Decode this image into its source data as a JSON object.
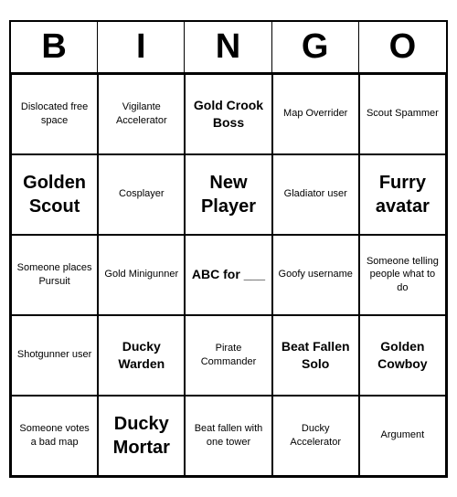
{
  "header": {
    "letters": [
      "B",
      "I",
      "N",
      "G",
      "O"
    ]
  },
  "cells": [
    {
      "text": "Dislocated free space",
      "size": "small"
    },
    {
      "text": "Vigilante Accelerator",
      "size": "small"
    },
    {
      "text": "Gold Crook Boss",
      "size": "medium"
    },
    {
      "text": "Map Overrider",
      "size": "small"
    },
    {
      "text": "Scout Spammer",
      "size": "small"
    },
    {
      "text": "Golden Scout",
      "size": "large"
    },
    {
      "text": "Cosplayer",
      "size": "small"
    },
    {
      "text": "New Player",
      "size": "large"
    },
    {
      "text": "Gladiator user",
      "size": "small"
    },
    {
      "text": "Furry avatar",
      "size": "large"
    },
    {
      "text": "Someone places Pursuit",
      "size": "small"
    },
    {
      "text": "Gold Minigunner",
      "size": "small"
    },
    {
      "text": "ABC for ___",
      "size": "medium"
    },
    {
      "text": "Goofy username",
      "size": "small"
    },
    {
      "text": "Someone telling people what to do",
      "size": "small"
    },
    {
      "text": "Shotgunner user",
      "size": "small"
    },
    {
      "text": "Ducky Warden",
      "size": "medium"
    },
    {
      "text": "Pirate Commander",
      "size": "small"
    },
    {
      "text": "Beat Fallen Solo",
      "size": "medium"
    },
    {
      "text": "Golden Cowboy",
      "size": "medium"
    },
    {
      "text": "Someone votes a bad map",
      "size": "small"
    },
    {
      "text": "Ducky Mortar",
      "size": "large"
    },
    {
      "text": "Beat fallen with one tower",
      "size": "small"
    },
    {
      "text": "Ducky Accelerator",
      "size": "small"
    },
    {
      "text": "Argument",
      "size": "small"
    }
  ]
}
